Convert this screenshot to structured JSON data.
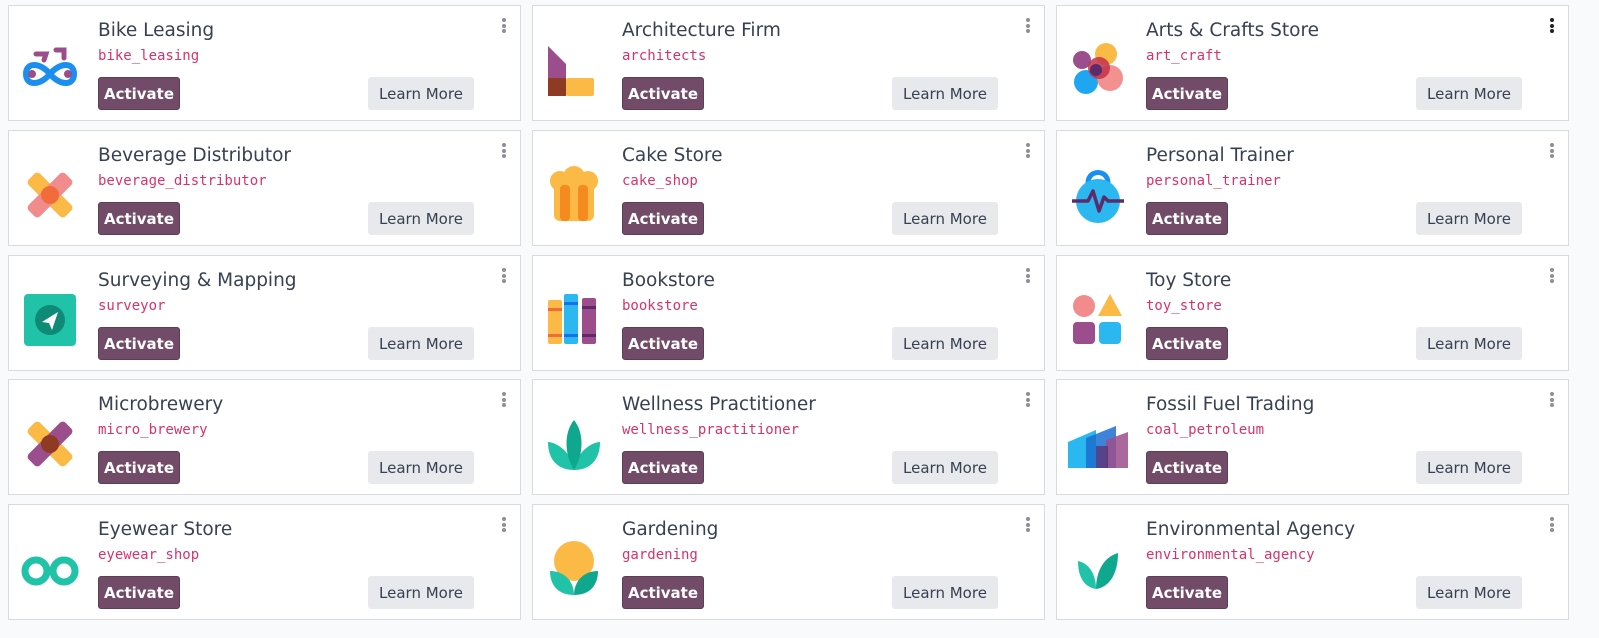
{
  "buttons": {
    "activate_label": "Activate",
    "learn_more_label": "Learn More"
  },
  "modules": [
    {
      "title": "Bike Leasing",
      "tech": "bike_leasing",
      "icon": "bicycle-icon"
    },
    {
      "title": "Architecture Firm",
      "tech": "architects",
      "icon": "architecture-icon"
    },
    {
      "title": "Arts & Crafts Store",
      "tech": "art_craft",
      "icon": "color-circles-icon"
    },
    {
      "title": "Beverage Distributor",
      "tech": "beverage_distributor",
      "icon": "crossed-bottles-icon"
    },
    {
      "title": "Cake Store",
      "tech": "cake_shop",
      "icon": "chef-hat-icon"
    },
    {
      "title": "Personal Trainer",
      "tech": "personal_trainer",
      "icon": "kettlebell-icon"
    },
    {
      "title": "Surveying & Mapping",
      "tech": "surveyor",
      "icon": "compass-icon"
    },
    {
      "title": "Bookstore",
      "tech": "bookstore",
      "icon": "books-icon"
    },
    {
      "title": "Toy Store",
      "tech": "toy_store",
      "icon": "toy-shapes-icon"
    },
    {
      "title": "Microbrewery",
      "tech": "micro_brewery",
      "icon": "crossed-bottles-icon"
    },
    {
      "title": "Wellness Practitioner",
      "tech": "wellness_practitioner",
      "icon": "lotus-icon"
    },
    {
      "title": "Fossil Fuel Trading",
      "tech": "coal_petroleum",
      "icon": "factory-icon"
    },
    {
      "title": "Eyewear Store",
      "tech": "eyewear_shop",
      "icon": "glasses-icon"
    },
    {
      "title": "Gardening",
      "tech": "gardening",
      "icon": "sun-plant-icon"
    },
    {
      "title": "Environmental Agency",
      "tech": "environmental_agency",
      "icon": "leaf-icon"
    }
  ]
}
